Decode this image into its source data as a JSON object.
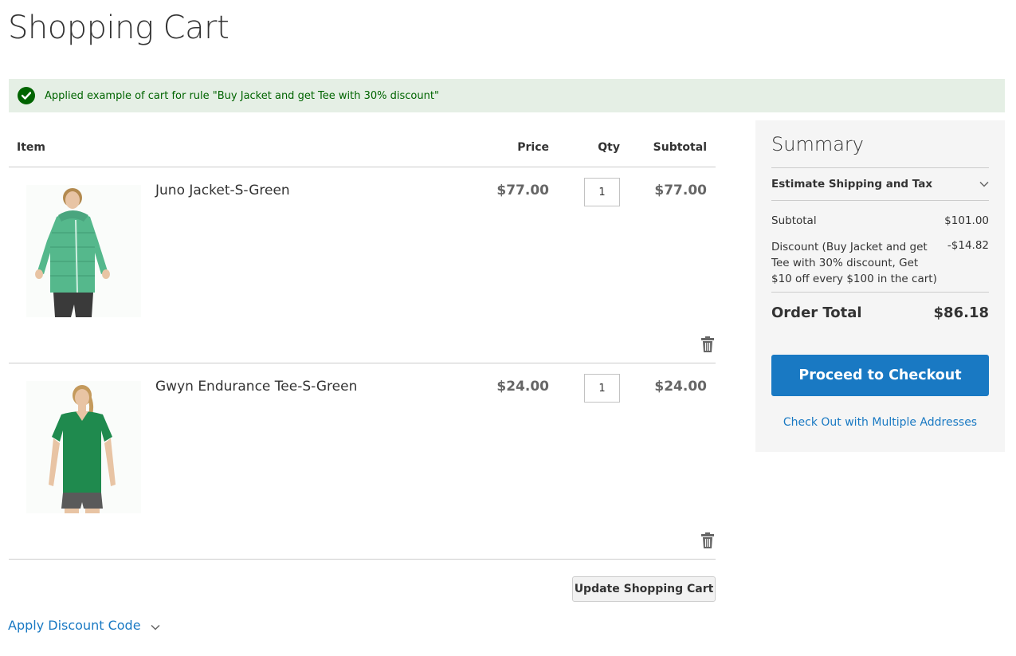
{
  "page": {
    "title": "Shopping Cart"
  },
  "message": {
    "text": "Applied example of cart for rule \"Buy Jacket and get Tee with 30% discount\"",
    "color": "#006400",
    "background": "#e5efe5"
  },
  "cart": {
    "headers": {
      "item": "Item",
      "price": "Price",
      "qty": "Qty",
      "subtotal": "Subtotal"
    },
    "items": [
      {
        "name": "Juno Jacket-S-Green",
        "price": "$77.00",
        "qty": "1",
        "subtotal": "$77.00",
        "image": "green-jacket-photo"
      },
      {
        "name": "Gwyn Endurance Tee-S-Green",
        "price": "$24.00",
        "qty": "1",
        "subtotal": "$24.00",
        "image": "green-tee-photo"
      }
    ],
    "update_label": "Update Shopping Cart",
    "discount_label": "Apply Discount Code"
  },
  "summary": {
    "title": "Summary",
    "shipping_label": "Estimate Shipping and Tax",
    "subtotal_label": "Subtotal",
    "subtotal_value": "$101.00",
    "discount_label": "Discount (Buy Jacket and get Tee with 30% discount, Get $10 off every $100 in the cart)",
    "discount_value": "-$14.82",
    "total_label": "Order Total",
    "total_value": "$86.18",
    "checkout_label": "Proceed to Checkout",
    "multi_label": "Check Out with Multiple Addresses"
  },
  "colors": {
    "accent": "#1979c3",
    "success": "#006400",
    "summary_bg": "#f5f5f5"
  }
}
